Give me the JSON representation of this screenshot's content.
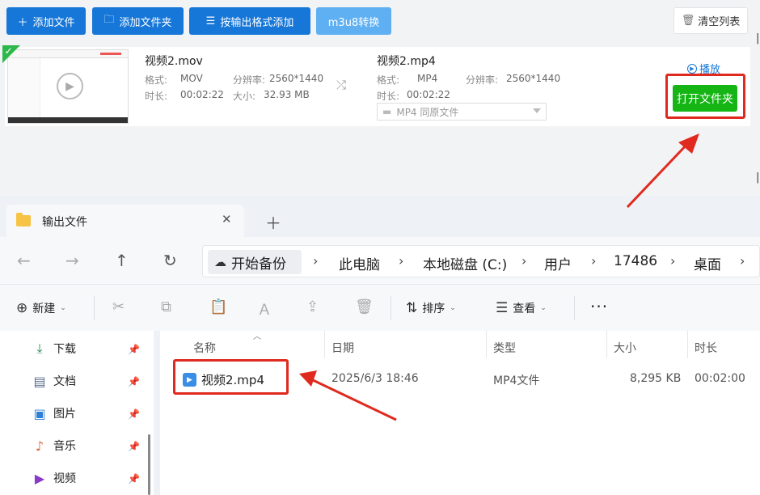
{
  "toolbar": {
    "add_file": "添加文件",
    "add_folder": "添加文件夹",
    "add_by_format": "按输出格式添加",
    "m3u8": "m3u8转换",
    "clear_list": "清空列表"
  },
  "task": {
    "source": {
      "name": "视频2.mov",
      "format_label": "格式:",
      "format": "MOV",
      "resolution_label": "分辨率:",
      "resolution": "2560*1440",
      "duration_label": "时长:",
      "duration": "00:02:22",
      "size_label": "大小:",
      "size": "32.93 MB"
    },
    "output": {
      "name": "视频2.mp4",
      "format_label": "格式:",
      "format": "MP4",
      "resolution_label": "分辨率:",
      "resolution": "2560*1440",
      "duration_label": "时长:",
      "duration": "00:02:22",
      "preset": "MP4   同原文件"
    },
    "play_label": "播放",
    "open_folder_label": "打开文件夹"
  },
  "explorer": {
    "tab_title": "输出文件",
    "backup_label": "开始备份",
    "breadcrumbs": [
      "此电脑",
      "本地磁盘 (C:)",
      "用户",
      "17486",
      "桌面"
    ],
    "commands": {
      "new": "新建",
      "sort": "排序",
      "view": "查看"
    },
    "sidebar": [
      {
        "label": "下载",
        "icon": "download-icon"
      },
      {
        "label": "文档",
        "icon": "document-icon"
      },
      {
        "label": "图片",
        "icon": "pictures-icon"
      },
      {
        "label": "音乐",
        "icon": "music-icon"
      },
      {
        "label": "视频",
        "icon": "video-icon"
      }
    ],
    "columns": {
      "name": "名称",
      "date": "日期",
      "type": "类型",
      "size": "大小",
      "duration": "时长"
    },
    "files": [
      {
        "name": "视频2.mp4",
        "date": "2025/6/3 18:46",
        "type": "MP4文件",
        "size": "8,295 KB",
        "duration": "00:02:00"
      }
    ]
  },
  "colors": {
    "primary_blue": "#1677d8",
    "green_button": "#14b514",
    "annotation_red": "#e02a1f"
  }
}
